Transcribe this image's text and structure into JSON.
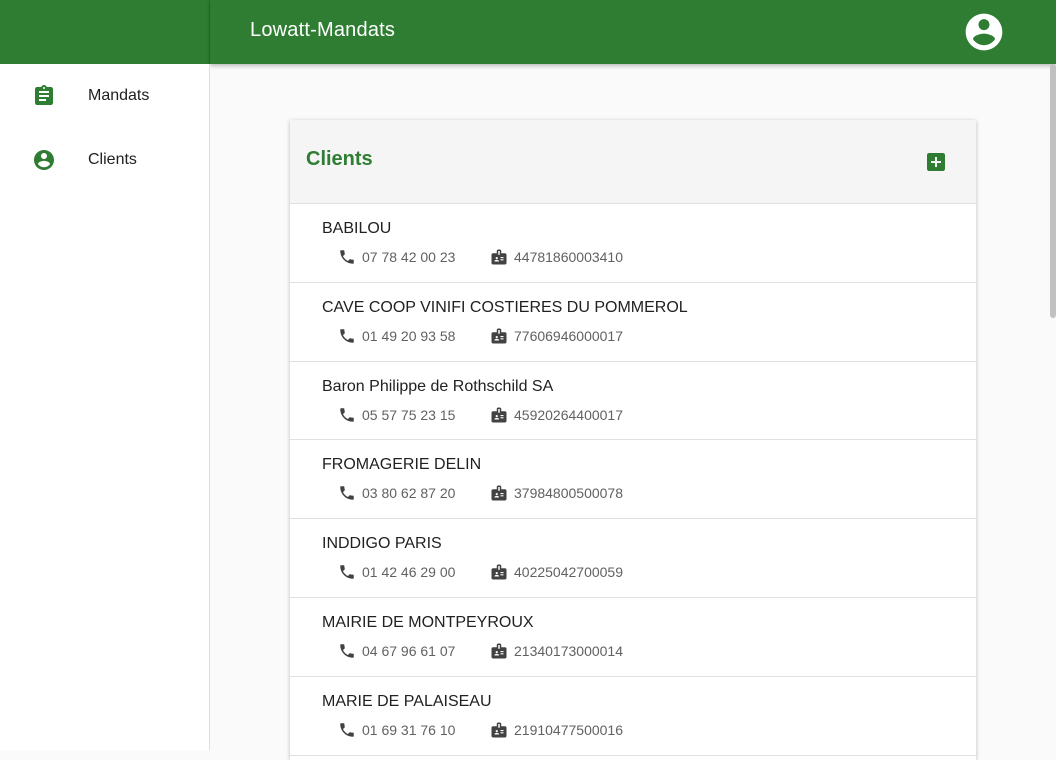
{
  "app": {
    "title": "Lowatt-Mandats"
  },
  "sidebar": {
    "items": [
      {
        "label": "Mandats",
        "icon": "assignment-icon"
      },
      {
        "label": "Clients",
        "icon": "account-circle-icon"
      }
    ]
  },
  "main": {
    "card_title": "Clients",
    "clients": [
      {
        "name": "BABILOU",
        "phone": "07 78 42 00 23",
        "siret": "44781860003410"
      },
      {
        "name": "CAVE COOP VINIFI COSTIERES DU POMMEROL",
        "phone": "01 49 20 93 58",
        "siret": "77606946000017"
      },
      {
        "name": "Baron Philippe de Rothschild SA",
        "phone": "05 57 75 23 15",
        "siret": "45920264400017"
      },
      {
        "name": "FROMAGERIE DELIN",
        "phone": "03 80 62 87 20",
        "siret": "37984800500078"
      },
      {
        "name": "INDDIGO PARIS",
        "phone": "01 42 46 29 00",
        "siret": "40225042700059"
      },
      {
        "name": "MAIRIE DE MONTPEYROUX",
        "phone": "04 67 96 61 07",
        "siret": "21340173000014"
      },
      {
        "name": "MARIE DE PALAISEAU",
        "phone": "01 69 31 76 10",
        "siret": "21910477500016"
      }
    ]
  },
  "colors": {
    "primary": "#2e7d32",
    "icon": "#424242"
  }
}
